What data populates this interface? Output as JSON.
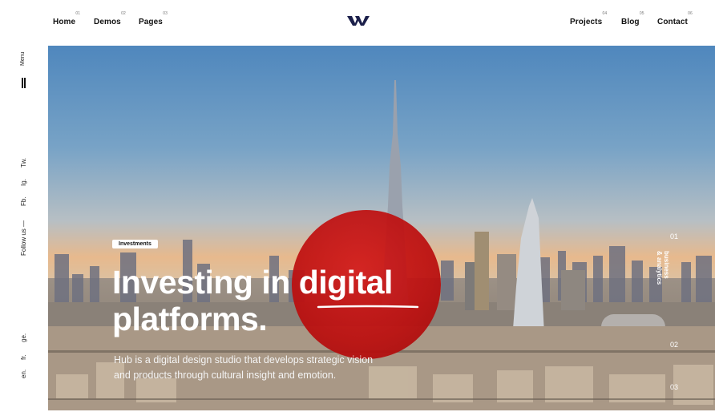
{
  "nav": {
    "left": [
      {
        "label": "Home",
        "num": "01"
      },
      {
        "label": "Demos",
        "num": "02"
      },
      {
        "label": "Pages",
        "num": "03"
      }
    ],
    "right": [
      {
        "label": "Projects",
        "num": "04"
      },
      {
        "label": "Blog",
        "num": "05"
      },
      {
        "label": "Contact",
        "num": "06"
      }
    ]
  },
  "logo": {
    "icon": "w-logo-icon",
    "color": "#1b1f4a"
  },
  "sidebar": {
    "menu_label": "Menu",
    "follow_label": "Follow us —",
    "social": [
      "Fb.",
      "Ig.",
      "Tw."
    ],
    "languages": [
      "en.",
      "fr.",
      "ge."
    ]
  },
  "hero": {
    "badge": "Investments",
    "headline_line1": "Investing in digital",
    "headline_line2": "platforms.",
    "subtitle_line1": "Hub is a digital design studio that develops strategic vision",
    "subtitle_line2": "and products through cultural insight and emotion.",
    "accent_color": "#c30f0f"
  },
  "slider": {
    "numbers": [
      "01",
      "02",
      "03"
    ],
    "active_label_line1": "business",
    "active_label_line2": "& analytics"
  }
}
